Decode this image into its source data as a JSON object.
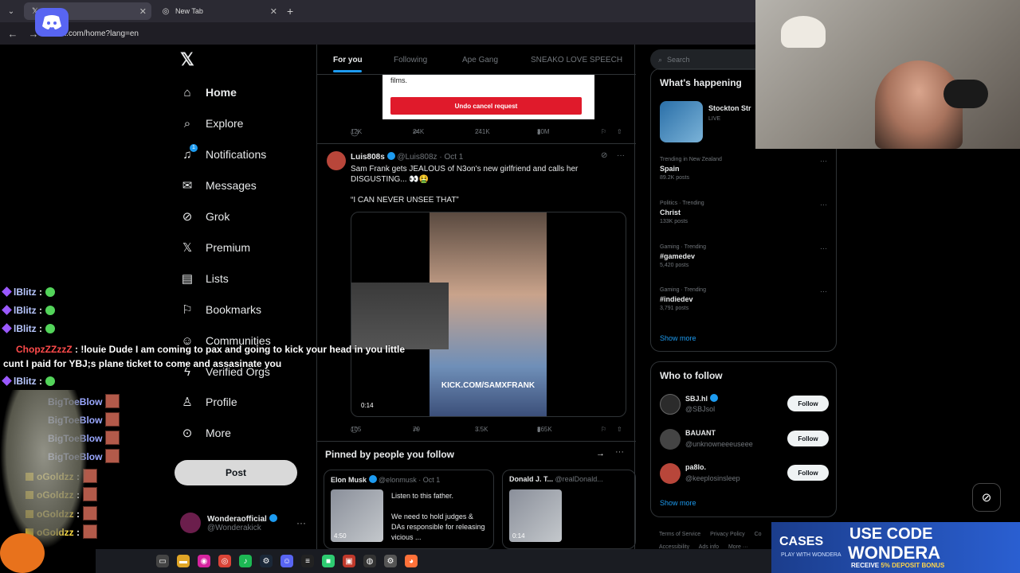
{
  "browser": {
    "tabs": [
      {
        "label": "/ X",
        "active": true
      },
      {
        "label": "New Tab",
        "active": false
      }
    ],
    "url": "x.com/home?lang=en"
  },
  "sidebar": {
    "items": [
      {
        "label": "Home",
        "icon": "home-icon"
      },
      {
        "label": "Explore",
        "icon": "search-icon"
      },
      {
        "label": "Notifications",
        "icon": "bell-icon",
        "badge": "1"
      },
      {
        "label": "Messages",
        "icon": "envelope-icon"
      },
      {
        "label": "Grok",
        "icon": "grok-icon"
      },
      {
        "label": "Premium",
        "icon": "x-icon"
      },
      {
        "label": "Lists",
        "icon": "list-icon"
      },
      {
        "label": "Bookmarks",
        "icon": "bookmark-icon"
      },
      {
        "label": "Communities",
        "icon": "people-icon"
      },
      {
        "label": "Verified Orgs",
        "icon": "lightning-icon"
      },
      {
        "label": "Profile",
        "icon": "person-icon"
      },
      {
        "label": "More",
        "icon": "more-circle-icon"
      }
    ],
    "post_label": "Post",
    "account": {
      "name": "Wonderaofficial",
      "handle": "@Wonderakick"
    }
  },
  "feed": {
    "tabs": [
      "For you",
      "Following",
      "Ape Gang",
      "SNEAKO LOVE SPEECH"
    ],
    "prev": {
      "text": "films.",
      "undo_label": "Undo cancel request",
      "stats": {
        "replies": "12K",
        "reposts": "24K",
        "likes": "241K",
        "views": "30M"
      }
    },
    "tweet": {
      "name": "Luis808s",
      "handle": "@Luis808z",
      "time": "Oct 1",
      "text": "Sam Frank gets JEALOUS of N3on's new girlfriend and calls her DISGUSTING... 👀🤮",
      "quote": "“I CAN NEVER UNSEE THAT”",
      "media_watermark": "KICK.COM/SAMXFRANK",
      "duration": "0:14",
      "stats": {
        "replies": "105",
        "reposts": "79",
        "likes": "3.5K",
        "views": "865K"
      }
    },
    "pinned": {
      "title": "Pinned by people you follow",
      "cards": [
        {
          "name": "Elon Musk",
          "handle": "@elonmusk",
          "time": "Oct 1",
          "duration": "4:50",
          "text": "Listen to this father.\n\nWe need to hold judges & DAs responsible for releasing vicious ..."
        },
        {
          "name": "Donald J. T...",
          "handle": "@realDonald...",
          "duration": "0:14"
        }
      ]
    }
  },
  "right": {
    "search_placeholder": "Search",
    "happening": {
      "title": "What's happening",
      "live": {
        "title": "Stockton Str",
        "tag": "LIVE"
      },
      "trends": [
        {
          "context": "Trending in New Zealand",
          "topic": "Spain",
          "posts": "89.2K posts"
        },
        {
          "context": "Politics · Trending",
          "topic": "Christ",
          "posts": "133K posts"
        },
        {
          "context": "Gaming · Trending",
          "topic": "#gamedev",
          "posts": "5,420 posts"
        },
        {
          "context": "Gaming · Trending",
          "topic": "#indiedev",
          "posts": "3,791 posts"
        }
      ],
      "show_more": "Show more"
    },
    "who_to_follow": {
      "title": "Who to follow",
      "users": [
        {
          "name": "SBJ.hl",
          "handle": "@SBJsol",
          "verified": true,
          "color": "#2b2b2b"
        },
        {
          "name": "BAUANT",
          "handle": "@unknowneeeuseee",
          "verified": false,
          "color": "#444444"
        },
        {
          "name": "pa8lo.",
          "handle": "@keeplosinsleep",
          "verified": false,
          "color": "#b8463a"
        }
      ],
      "follow_label": "Follow",
      "show_more": "Show more"
    },
    "footer": [
      "Terms of Service",
      "Privacy Policy",
      "Co",
      "Accessibility",
      "Ads info",
      "More ···"
    ]
  },
  "stream": {
    "chat": [
      {
        "user": "lBlitz",
        "sep": ":"
      },
      {
        "user": "lBlitz",
        "sep": ":"
      },
      {
        "user": "lBlitz",
        "sep": ":"
      },
      {
        "user": "ChopzZZzzZ",
        "sep": ":",
        "msg": "!louie Dude I am coming to pax and going to kick your head in you little cunt I paid for YBJ;s plane ticket to come and assasinate you"
      },
      {
        "user": "lBlitz",
        "sep": ":"
      },
      {
        "user": "BigToeBlow",
        "sep": ":"
      },
      {
        "user": "BigToeBlow",
        "sep": ":"
      },
      {
        "user": "BigToeBlow",
        "sep": ":"
      },
      {
        "user": "BigToeBlow",
        "sep": ":"
      },
      {
        "user": "oGoldzz",
        "sep": ":"
      },
      {
        "user": "oGoldzz",
        "sep": ":"
      },
      {
        "user": "oGoldzz",
        "sep": ":"
      },
      {
        "user": "oGoldzz",
        "sep": ":"
      }
    ],
    "ad": {
      "brand": "CASES",
      "brand_sub": "PLAY WITH WONDERA",
      "use": "USE CODE",
      "code": "WONDERA",
      "receive": "RECEIVE",
      "bonus": "5% DEPOSIT BONUS"
    }
  }
}
